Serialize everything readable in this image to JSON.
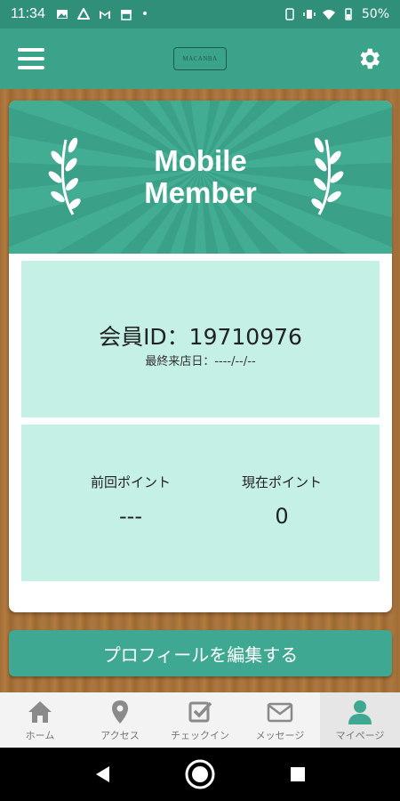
{
  "status_bar": {
    "time": "11:34",
    "battery": "50%"
  },
  "app_bar": {
    "logo_text": "MACANBA"
  },
  "hero": {
    "title_line1": "Mobile",
    "title_line2": "Member"
  },
  "member": {
    "id_label": "会員ID：19710976",
    "last_visit": "最終来店日：----/--/--"
  },
  "points": {
    "previous_label": "前回ポイント",
    "previous_value": "---",
    "current_label": "現在ポイント",
    "current_value": "0"
  },
  "edit_button": "プロフィールを編集する",
  "tabs": [
    {
      "label": "ホーム",
      "icon": "home-icon"
    },
    {
      "label": "アクセス",
      "icon": "map-pin-icon"
    },
    {
      "label": "チェックイン",
      "icon": "checkin-icon"
    },
    {
      "label": "メッセージ",
      "icon": "mail-icon"
    },
    {
      "label": "マイページ",
      "icon": "person-icon"
    }
  ],
  "colors": {
    "header": "#3ba38a",
    "status_bar": "#2f8f79",
    "panel": "#c4f0e5",
    "button": "#3ea892",
    "active_icon": "#3ea892",
    "inactive_icon": "#8a8a8a"
  }
}
